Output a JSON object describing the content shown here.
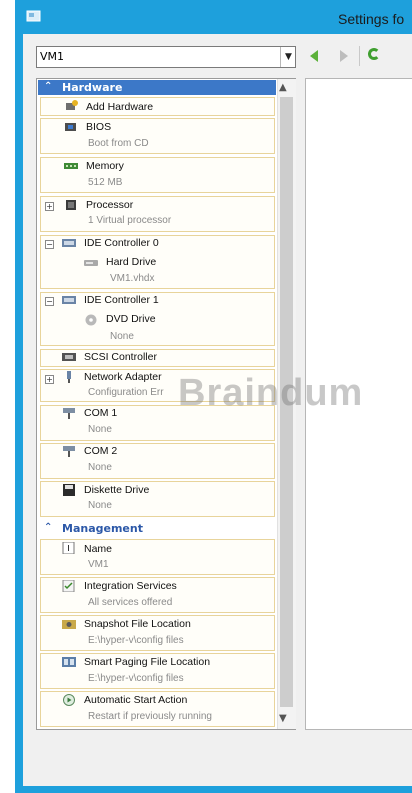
{
  "window": {
    "title": "Settings fo"
  },
  "toolbar": {
    "vm_selector": "VM1"
  },
  "hardware": {
    "section_label": "Hardware",
    "items": [
      {
        "label": "Add Hardware",
        "sub": ""
      },
      {
        "label": "BIOS",
        "sub": "Boot from CD"
      },
      {
        "label": "Memory",
        "sub": "512 MB"
      },
      {
        "label": "Processor",
        "sub": "1 Virtual processor"
      },
      {
        "label": "IDE Controller 0",
        "sub": ""
      },
      {
        "label": "Hard Drive",
        "sub": "VM1.vhdx"
      },
      {
        "label": "IDE Controller 1",
        "sub": ""
      },
      {
        "label": "DVD Drive",
        "sub": "None"
      },
      {
        "label": "SCSI Controller",
        "sub": ""
      },
      {
        "label": "Network Adapter",
        "sub": "Configuration Err"
      },
      {
        "label": "COM 1",
        "sub": "None"
      },
      {
        "label": "COM 2",
        "sub": "None"
      },
      {
        "label": "Diskette Drive",
        "sub": "None"
      }
    ]
  },
  "management": {
    "section_label": "Management",
    "items": [
      {
        "label": "Name",
        "sub": "VM1"
      },
      {
        "label": "Integration Services",
        "sub": "All services offered"
      },
      {
        "label": "Snapshot File Location",
        "sub": "E:\\hyper-v\\config files"
      },
      {
        "label": "Smart Paging File Location",
        "sub": "E:\\hyper-v\\config files"
      },
      {
        "label": "Automatic Start Action",
        "sub": "Restart if previously running"
      }
    ]
  },
  "watermark": "Braindum",
  "colors": {
    "title_bar": "#1ea0dc",
    "section_header": "#3c78c8",
    "selection_border": "#e8d49b",
    "nav_green": "#5cb13a"
  }
}
